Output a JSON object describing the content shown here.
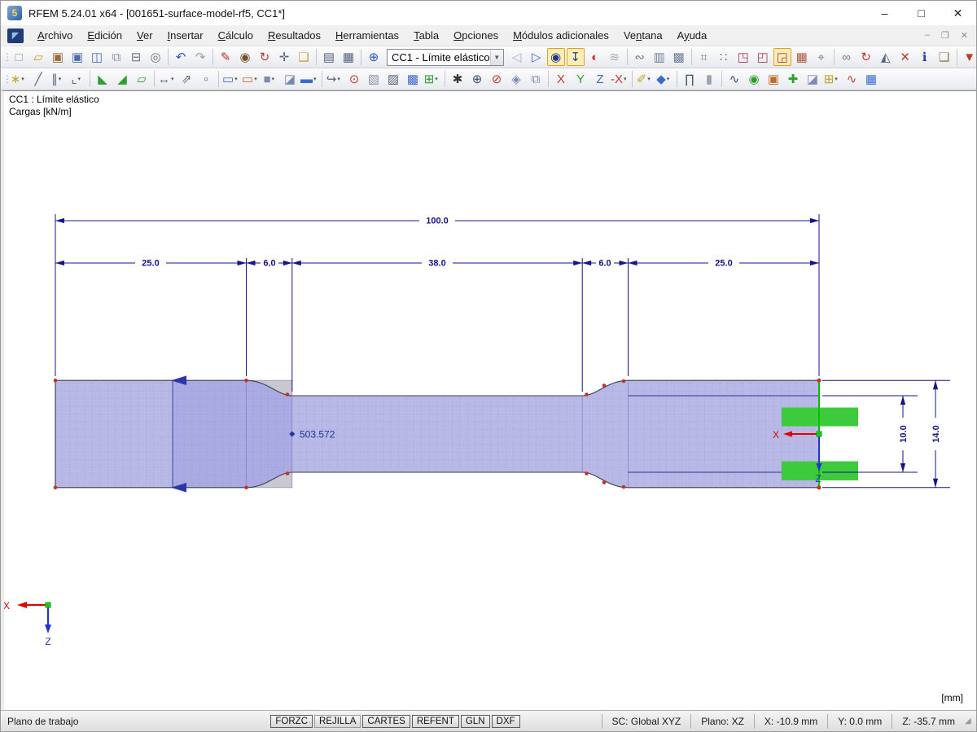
{
  "window": {
    "title": "RFEM 5.24.01 x64 - [001651-surface-model-rf5, CC1*]",
    "app_icon_glyph": "5",
    "controls": {
      "minimize": "–",
      "maximize": "□",
      "close": "✕"
    }
  },
  "menubar": {
    "logo_glyph": "◤",
    "items": [
      {
        "id": "archivo",
        "label": "Archivo",
        "u": 0
      },
      {
        "id": "edicion",
        "label": "Edición",
        "u": 0
      },
      {
        "id": "ver",
        "label": "Ver",
        "u": 0
      },
      {
        "id": "insertar",
        "label": "Insertar",
        "u": 0
      },
      {
        "id": "calculo",
        "label": "Cálculo",
        "u": 0
      },
      {
        "id": "resultados",
        "label": "Resultados",
        "u": 0
      },
      {
        "id": "herramientas",
        "label": "Herramientas",
        "u": 0
      },
      {
        "id": "tabla",
        "label": "Tabla",
        "u": 0
      },
      {
        "id": "opciones",
        "label": "Opciones",
        "u": 0
      },
      {
        "id": "modulos-adicionales",
        "label": "Módulos adicionales",
        "u": 0
      },
      {
        "id": "ventana",
        "label": "Ventana",
        "u": 2
      },
      {
        "id": "ayuda",
        "label": "Ayuda",
        "u": 1
      }
    ],
    "mdi_controls": {
      "minimize": "–",
      "restore": "❐",
      "close": "✕"
    }
  },
  "toolbar1": {
    "left": [
      {
        "grip": true
      },
      {
        "n": "new-document-button",
        "g": "□",
        "c": "#8a93a6"
      },
      {
        "n": "open-project-button",
        "g": "▱",
        "c": "#d29a2f"
      },
      {
        "n": "open-model-button",
        "g": "▣",
        "c": "#9a6a34"
      },
      {
        "n": "save-model-button",
        "g": "▣",
        "c": "#4c6cb0"
      },
      {
        "n": "save-button",
        "g": "◫",
        "c": "#4c6cb0"
      },
      {
        "n": "copy-button",
        "g": "⧉",
        "c": "#8a93a6"
      },
      {
        "n": "print-button",
        "g": "⊟",
        "c": "#6b7686"
      },
      {
        "n": "print-preview-button",
        "g": "◎",
        "c": "#6b7686"
      },
      {
        "sep": true
      },
      {
        "n": "undo-button",
        "g": "↶",
        "c": "#2a57c8"
      },
      {
        "n": "redo-button",
        "g": "↷",
        "c": "#9aa2ae"
      },
      {
        "sep": true
      },
      {
        "n": "edit-loads-button",
        "g": "✎",
        "c": "#b03030"
      },
      {
        "n": "show-objects-button",
        "g": "◉",
        "c": "#7a4e2a"
      },
      {
        "n": "regenerate-button",
        "g": "↻",
        "c": "#c03a2a"
      },
      {
        "n": "edit-values-button",
        "g": "✛",
        "c": "#55657e"
      },
      {
        "n": "new-window-button",
        "g": "❏",
        "c": "#d29a2f"
      },
      {
        "sep": true
      },
      {
        "n": "table-list-button",
        "g": "▤",
        "c": "#55657e"
      },
      {
        "n": "table-grid-button",
        "g": "▦",
        "c": "#55657e"
      },
      {
        "sep": true
      },
      {
        "n": "load-case-button",
        "g": "⊕",
        "c": "#2a57c8"
      }
    ],
    "combo": {
      "value": "CC1 - Límite elástico",
      "caret": "▼"
    },
    "right": [
      {
        "n": "previous-load-case-button",
        "g": "◁",
        "c": "#9fb0d8"
      },
      {
        "n": "next-load-case-button",
        "g": "▷",
        "c": "#3a6ad0"
      },
      {
        "n": "show-loads-toggle",
        "g": "◉",
        "c": "#223a8c",
        "tog": 1
      },
      {
        "n": "show-load-values-toggle",
        "g": "↧",
        "c": "#223a8c",
        "tog": 1
      },
      {
        "n": "show-results-button",
        "g": "◐",
        "c": "#c03a2a"
      },
      {
        "n": "show-result-values-button",
        "g": "≋",
        "c": "#a8b0ba"
      },
      {
        "sep": true
      },
      {
        "n": "connect-members-button",
        "g": "∾",
        "c": "#70809a"
      },
      {
        "n": "frame-panel-button",
        "g": "▥",
        "c": "#70809a"
      },
      {
        "n": "frame-panel-2-button",
        "g": "▩",
        "c": "#70809a"
      },
      {
        "sep": true
      },
      {
        "n": "snap-button",
        "g": "⌗",
        "c": "#70809a"
      },
      {
        "n": "grid-button",
        "g": "∷",
        "c": "#70809a"
      },
      {
        "n": "work-plane-xy-button",
        "g": "◳",
        "c": "#b03a4a"
      },
      {
        "n": "work-plane-yz-button",
        "g": "◰",
        "c": "#b03a4a"
      },
      {
        "n": "work-plane-xz-toggle",
        "g": "◲",
        "c": "#b03a4a",
        "tog": 1
      },
      {
        "n": "fe-mesh-button",
        "g": "▦",
        "c": "#b05a3a"
      },
      {
        "n": "select-plane-button",
        "g": "⌖",
        "c": "#70809a"
      },
      {
        "sep": true
      },
      {
        "n": "select-objects-button",
        "g": "∞",
        "c": "#70809a"
      },
      {
        "n": "rotate-view-button",
        "g": "↻",
        "c": "#c03a2a"
      },
      {
        "n": "mirror-button",
        "g": "◭",
        "c": "#55657e"
      },
      {
        "n": "delete-button",
        "g": "✕",
        "c": "#c03a2a"
      },
      {
        "n": "info-button",
        "g": "ℹ",
        "c": "#1f3fa6"
      },
      {
        "n": "comment-button",
        "g": "❏",
        "c": "#8a7a4a"
      },
      {
        "sep": true
      },
      {
        "n": "default-view-button",
        "g": "▼",
        "c": "#c03a2a"
      }
    ]
  },
  "toolbar2": {
    "items": [
      {
        "grip": true
      },
      {
        "n": "new-node-button",
        "g": "∗",
        "c": "#c8a020",
        "dd": 1
      },
      {
        "n": "new-line-button",
        "g": "╱",
        "c": "#55657e"
      },
      {
        "n": "new-member-button",
        "g": "∥",
        "c": "#55657e",
        "dd": 1
      },
      {
        "n": "new-polyline-button",
        "g": "⌞",
        "c": "#55657e",
        "dd": 1
      },
      {
        "sep": true
      },
      {
        "n": "nodal-support-button",
        "g": "◣",
        "c": "#2f9e2f"
      },
      {
        "n": "line-support-button",
        "g": "◢",
        "c": "#2f9e2f"
      },
      {
        "n": "surface-support-button",
        "g": "▱",
        "c": "#2f9e2f"
      },
      {
        "sep": true
      },
      {
        "n": "dimension-button",
        "g": "↔",
        "c": "#55657e",
        "dd": 1
      },
      {
        "n": "slope-button",
        "g": "⇗",
        "c": "#55657e"
      },
      {
        "n": "guide-lines-button",
        "g": "▫",
        "c": "#55657e"
      },
      {
        "sep": true
      },
      {
        "n": "new-surface-button",
        "g": "▭",
        "c": "#3a6ad0",
        "dd": 1
      },
      {
        "n": "new-opening-button",
        "g": "▭",
        "c": "#c06a2a",
        "dd": 1
      },
      {
        "n": "new-solid-button",
        "g": "■",
        "c": "#7a8ab0",
        "dd": 1
      },
      {
        "n": "new-block-button",
        "g": "◪",
        "c": "#7a8ab0"
      },
      {
        "n": "new-visual-object-button",
        "g": "▬",
        "c": "#3a6ad0",
        "dd": 1
      },
      {
        "sep": true
      },
      {
        "n": "generate-button",
        "g": "↪",
        "c": "#55657e",
        "dd": 1
      },
      {
        "n": "insert-node-button",
        "g": "⊙",
        "c": "#c03a2a"
      },
      {
        "n": "refine-mesh-button",
        "g": "▧",
        "c": "#8a93a6"
      },
      {
        "n": "refine-mesh-2-button",
        "g": "▨",
        "c": "#55657e"
      },
      {
        "n": "mesh-refinement-button",
        "g": "▩",
        "c": "#3a6ad0"
      },
      {
        "n": "mesh-generate-button",
        "g": "⊞",
        "c": "#2f9e2f",
        "dd": 1
      },
      {
        "sep": true
      },
      {
        "n": "zoom-window-button",
        "g": "✱",
        "c": "#333333"
      },
      {
        "n": "zoom-in-button",
        "g": "⊕",
        "c": "#33506e"
      },
      {
        "n": "zoom-out-button",
        "g": "⊘",
        "c": "#c03a2a"
      },
      {
        "n": "isometric-view-button",
        "g": "◈",
        "c": "#7a8ab0"
      },
      {
        "n": "copy-view-button",
        "g": "⧉",
        "c": "#7a8ab0"
      },
      {
        "sep": true
      },
      {
        "n": "view-x-button",
        "g": "X",
        "c": "#c03a2a"
      },
      {
        "n": "view-y-button",
        "g": "Y",
        "c": "#2f9e2f"
      },
      {
        "n": "view-z-button",
        "g": "Z",
        "c": "#3a6ad0"
      },
      {
        "n": "view-minus-x-button",
        "g": "-X",
        "c": "#c03a2a",
        "dd": 1
      },
      {
        "sep": true
      },
      {
        "n": "display-properties-button",
        "g": "✐",
        "c": "#c8a020",
        "dd": 1
      },
      {
        "n": "visual-style-button",
        "g": "◆",
        "c": "#3a6ad0",
        "dd": 1
      },
      {
        "sep": true
      },
      {
        "n": "measure-button",
        "g": "∏",
        "c": "#33506e"
      },
      {
        "n": "mouse-functions-button",
        "g": "▮",
        "c": "#9aa2ae"
      },
      {
        "sep": true
      },
      {
        "n": "member-results-button",
        "g": "∿",
        "c": "#33506e"
      },
      {
        "n": "surface-results-button",
        "g": "◉",
        "c": "#2f9e2f"
      },
      {
        "n": "solid-results-button",
        "g": "▣",
        "c": "#c06a2a"
      },
      {
        "n": "deformation-button",
        "g": "✚",
        "c": "#2f9e2f"
      },
      {
        "n": "smooth-results-button",
        "g": "◪",
        "c": "#7a8ab0"
      },
      {
        "n": "result-panels-button",
        "g": "⊞",
        "c": "#c8a020",
        "dd": 1
      },
      {
        "n": "result-diagram-button",
        "g": "∿",
        "c": "#c03a2a"
      },
      {
        "n": "result-table-button",
        "g": "▦",
        "c": "#3a6ad0"
      }
    ]
  },
  "canvas": {
    "header_line1": "CC1 : Límite elástico",
    "header_line2": "Cargas [kN/m]",
    "unit_label": "[mm]",
    "load_value": "503.572",
    "dims": {
      "total": "100.0",
      "seg1": "25.0",
      "seg2": "6.0",
      "seg3": "38.0",
      "seg4": "6.0",
      "seg5": "25.0",
      "inner_height": "10.0",
      "outer_height": "14.0"
    },
    "axes": {
      "x": "X",
      "z": "Z"
    },
    "colors": {
      "surface_fill": "#b9b9e8",
      "surface_gray": "#c8c8d2",
      "load_green": "#3dcb3d",
      "edge_green": "#00c000",
      "dim_navy": "#14148c",
      "axis_red": "#e00000",
      "axis_blue": "#2233cc"
    }
  },
  "statusbar": {
    "left": "Plano de trabajo",
    "toggles": [
      {
        "label": "FORZC",
        "pressed": true
      },
      {
        "label": "REJILLA",
        "pressed": false
      },
      {
        "label": "CARTES",
        "pressed": true
      },
      {
        "label": "REFENT",
        "pressed": true
      },
      {
        "label": "GLN",
        "pressed": true
      },
      {
        "label": "DXF",
        "pressed": true
      }
    ],
    "fields": [
      {
        "id": "sc",
        "text": "SC: Global XYZ"
      },
      {
        "id": "plano",
        "text": "Plano: XZ"
      },
      {
        "id": "x",
        "text": "X:  -10.9 mm"
      },
      {
        "id": "y",
        "text": "Y:  0.0 mm"
      },
      {
        "id": "z",
        "text": "Z:  -35.7 mm"
      }
    ]
  }
}
